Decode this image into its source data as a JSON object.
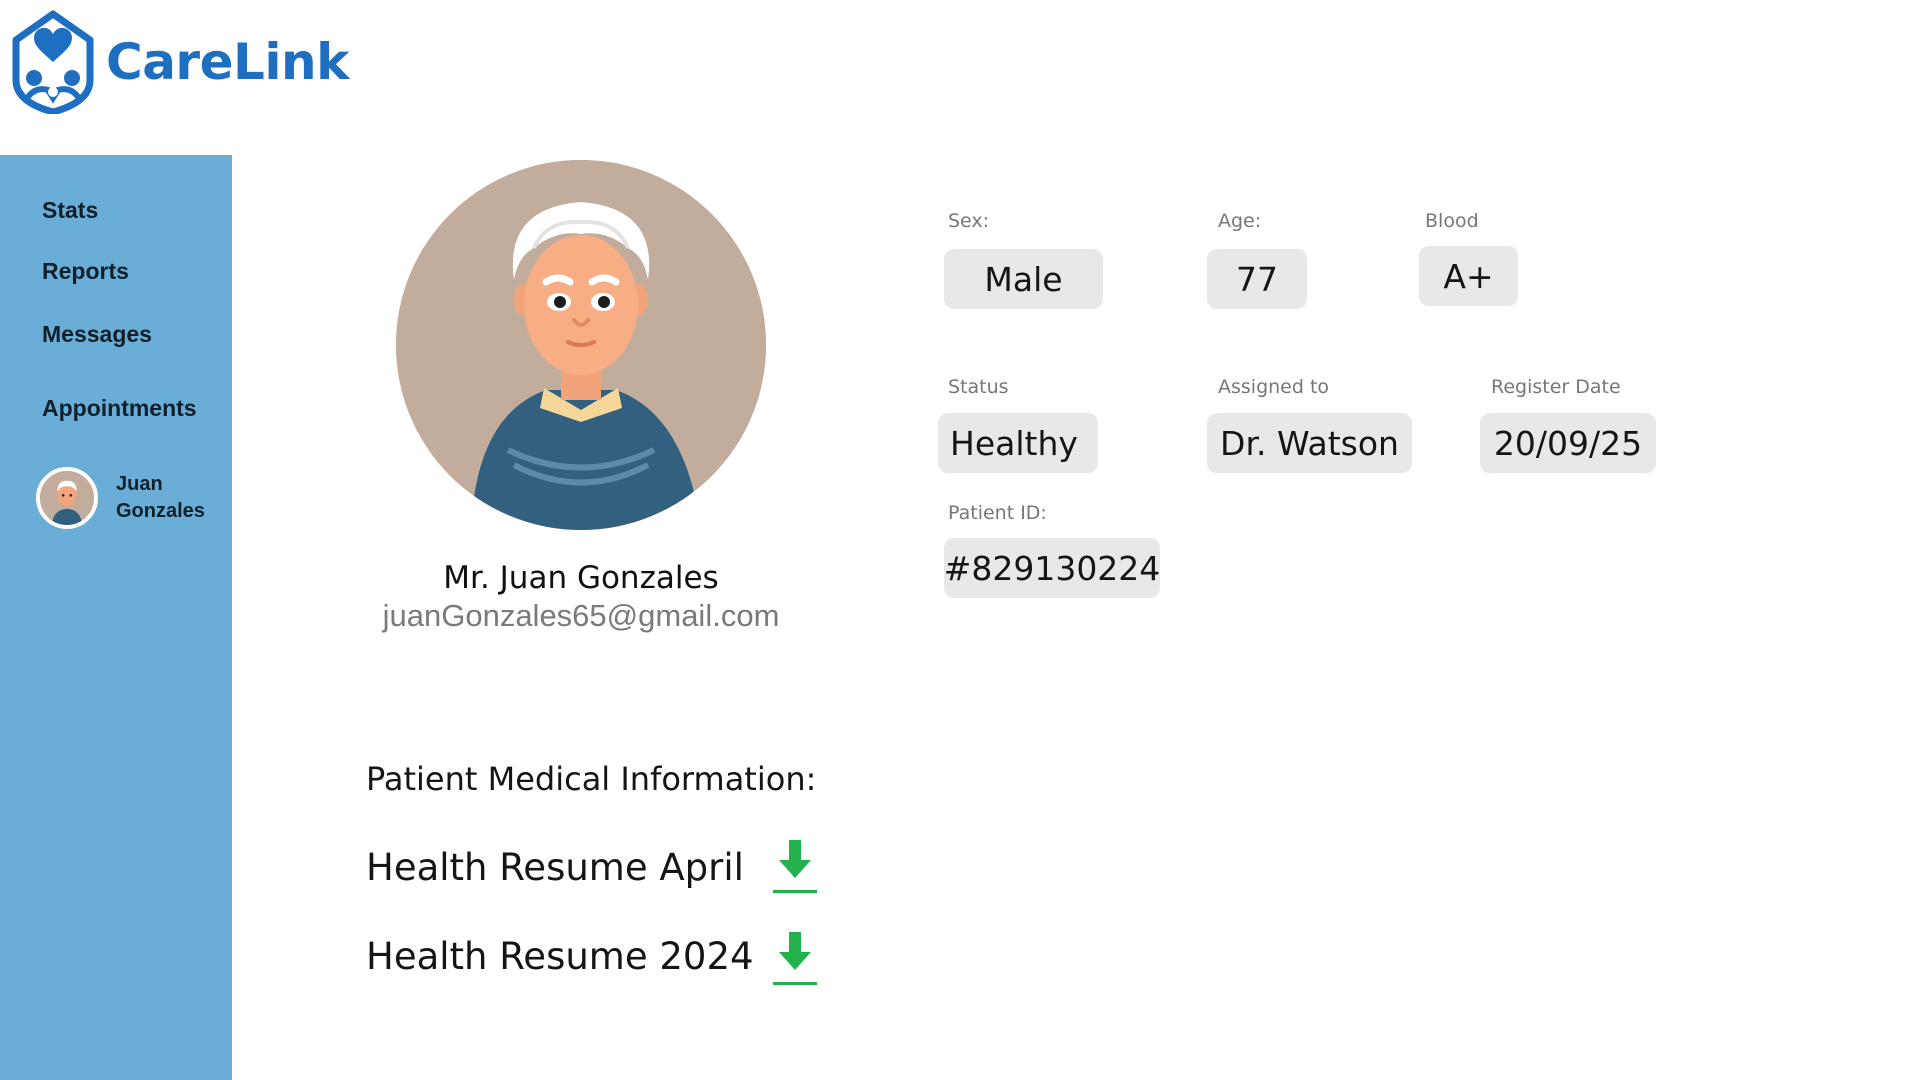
{
  "brand": {
    "name": "CareLink",
    "logo_icon": "house-heart-logo-icon",
    "color": "#1e6fc1"
  },
  "sidebar": {
    "background": "#6aaed8",
    "items": [
      {
        "label": "Stats"
      },
      {
        "label": "Reports"
      },
      {
        "label": "Messages"
      },
      {
        "label": "Appointments"
      }
    ],
    "user": {
      "name": "Juan Gonzales"
    }
  },
  "profile": {
    "name": "Mr. Juan Gonzales",
    "email": "juanGonzales65@gmail.com"
  },
  "fields": {
    "sex": {
      "label": "Sex:",
      "value": "Male"
    },
    "age": {
      "label": "Age:",
      "value": "77"
    },
    "blood": {
      "label": "Blood",
      "value": "A+"
    },
    "status": {
      "label": "Status",
      "value": "Healthy"
    },
    "assigned": {
      "label": "Assigned to",
      "value": "Dr. Watson"
    },
    "register": {
      "label": "Register Date",
      "value": "20/09/25"
    },
    "patient_id": {
      "label": "Patient ID:",
      "value": "#829130224"
    }
  },
  "medical": {
    "title": "Patient Medical Information:",
    "documents": [
      {
        "label": "Health Resume April",
        "icon": "download-icon"
      },
      {
        "label": "Health Resume 2024",
        "icon": "download-icon"
      }
    ],
    "download_color": "#22b14c"
  }
}
